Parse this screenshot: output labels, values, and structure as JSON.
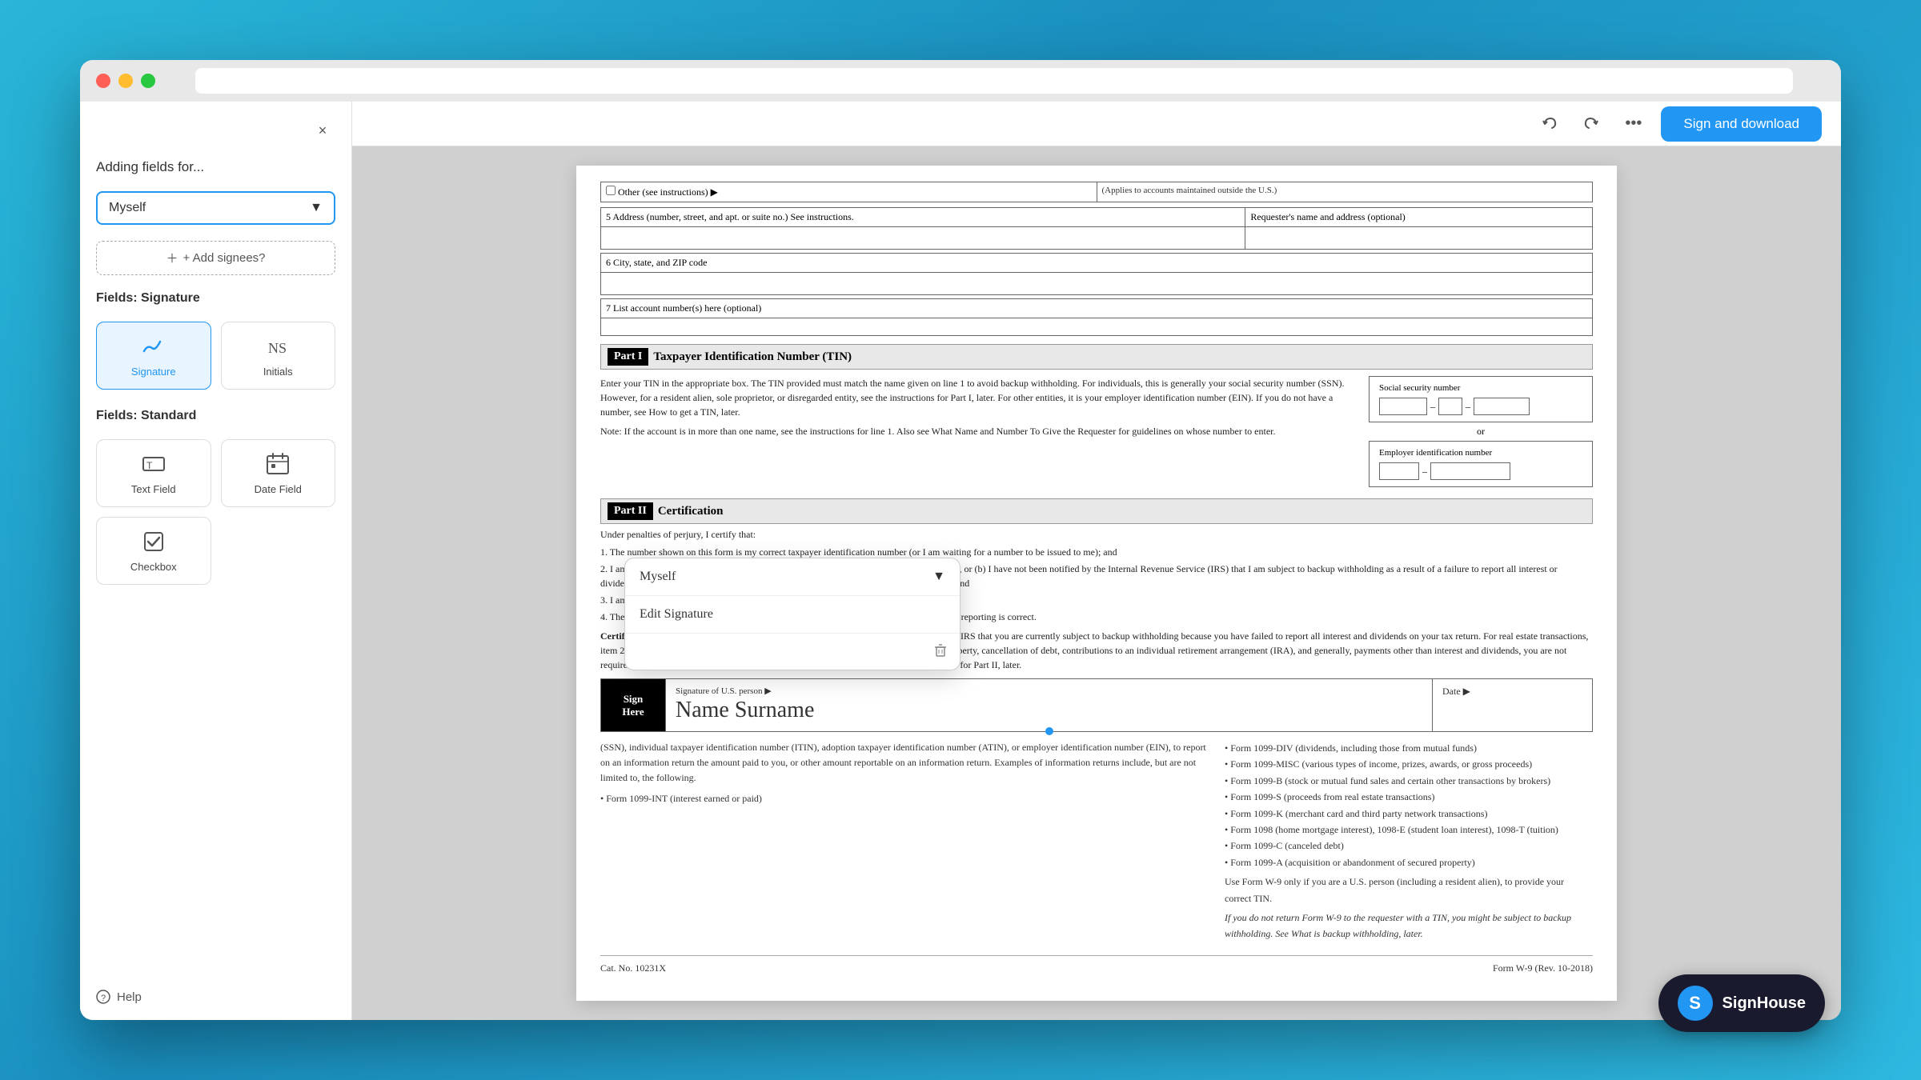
{
  "browser": {
    "url": ""
  },
  "toolbar": {
    "sign_download_label": "Sign and download",
    "more_icon": "•••"
  },
  "sidebar": {
    "close_label": "×",
    "adding_fields_label": "Adding fields for...",
    "signee_name": "Myself",
    "add_signees_label": "+ Add signees?",
    "fields_signature_label": "Fields: Signature",
    "signature_btn_label": "Signature",
    "initials_btn_label": "Initials",
    "fields_standard_label": "Fields: Standard",
    "text_field_label": "Text Field",
    "date_field_label": "Date Field",
    "checkbox_label": "Checkbox",
    "help_label": "Help"
  },
  "document": {
    "part1_title": "Part I",
    "part1_name": "Taxpayer Identification Number (TIN)",
    "part1_body": "Enter your TIN in the appropriate box. The TIN provided must match the name given on line 1 to avoid backup withholding. For individuals, this is generally your social security number (SSN). However, for a resident alien, sole proprietor, or disregarded entity, see the instructions for Part I, later. For other entities, it is your employer identification number (EIN). If you do not have a number, see How to get a TIN, later.",
    "part1_note": "Note: If the account is in more than one name, see the instructions for line 1. Also see What Name and Number To Give the Requester for guidelines on whose number to enter.",
    "ssn_label": "Social security number",
    "ein_label": "Employer identification number",
    "part2_title": "Part II",
    "part2_name": "Certification",
    "cert_intro": "Under penalties of perjury, I certify that:",
    "cert_items": [
      "1. The number shown on this form is my correct taxpayer identification number (or I am waiting for a number to be issued to me); and",
      "2. I am not subject to backup withholding because: (a) I am exempt from backup withholding, or (b) I have not been notified by the Internal Revenue Service (IRS) that I am subject to backup withholding as a result of a failure to report all interest or dividends, or (c) the IRS has notified me that I am no longer subject to backup withholding; and",
      "3. I am a U.S. citizen or other U.S. person (defined below); and",
      "4. The FATCA code(s) entered on this form (if any) indicating that I am exempt from FATCA reporting is correct."
    ],
    "cert_instructions": "Certification instructions. You must cross out item 2 above if you have been notified by the IRS that you are currently subject to backup withholding because you have failed to report all interest and dividends on your tax return. For real estate transactions, item 2 does not apply. For mortgage interest paid, acquisition or abandonment of secured property, cancellation of debt, contributions to an individual retirement arrangement (IRA), and generally, payments other than interest and dividends, you are not required to sign the certification, but you must provide your correct TIN. See the instructions for Part II, later.",
    "sign_here_label": "Sign Here",
    "signature_of_label": "Signature of U.S. person ▶",
    "signature_value": "Name Surname",
    "date_label": "Date ▶",
    "cat_no": "Cat. No. 10231X",
    "form_name": "Form W-9 (Rev. 10-2018)",
    "address_label": "5 Address (number, street, and apt. or suite no.) See instructions.",
    "requester_label": "Requester's name and address (optional)",
    "city_label": "6 City, state, and ZIP code",
    "account_label": "7 List account number(s) here (optional)",
    "other_label": "Other (see instructions) ▶",
    "applies_label": "(Applies to accounts maintained outside the U.S.)"
  },
  "popup": {
    "signee_name": "Myself",
    "edit_signature_label": "Edit Signature"
  },
  "signhouse": {
    "logo_letter": "S",
    "brand_name": "SignHouse"
  },
  "right_panel": {
    "items": [
      "• Form 1099-DIV (dividends, including those from mutual funds)",
      "• Form 1099-MISC (various types of income, prizes, awards, or gross proceeds)",
      "• Form 1099-B (stock or mutual fund sales and certain other transactions by brokers)",
      "• Form 1099-S (proceeds from real estate transactions)",
      "• Form 1099-K (merchant card and third party network transactions)",
      "• Form 1098 (home mortgage interest), 1098-E (student loan interest), 1098-T (tuition)",
      "• Form 1099-C (canceled debt)",
      "• Form 1099-A (acquisition or abandonment of secured property)",
      "Use Form W-9 only if you are a U.S. person (including a resident alien), to provide your correct TIN.",
      "If you do not return Form W-9 to the requester with a TIN, you might be subject to backup withholding. See What is backup withholding, later."
    ]
  }
}
